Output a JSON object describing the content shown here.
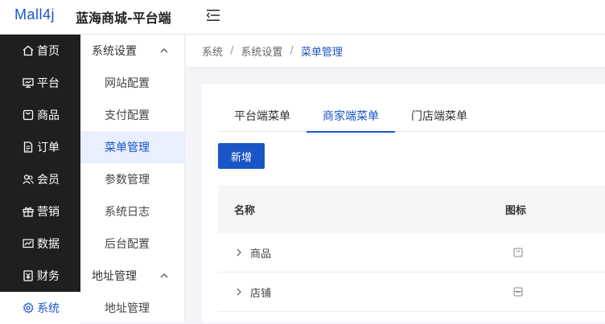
{
  "header": {
    "logo_text": "Mall4j",
    "app_title": "蓝海商城-平台端"
  },
  "primary_nav": [
    {
      "label": "首页",
      "icon": "home-icon"
    },
    {
      "label": "平台",
      "icon": "monitor-icon"
    },
    {
      "label": "商品",
      "icon": "goods-icon"
    },
    {
      "label": "订单",
      "icon": "order-icon"
    },
    {
      "label": "会员",
      "icon": "member-icon"
    },
    {
      "label": "营销",
      "icon": "gift-icon"
    },
    {
      "label": "数据",
      "icon": "chart-icon"
    },
    {
      "label": "财务",
      "icon": "finance-icon"
    },
    {
      "label": "系统",
      "icon": "gear-icon",
      "active": true
    }
  ],
  "secondary_nav": {
    "group1": "系统设置",
    "group1_items": [
      "网站配置",
      "支付配置",
      "菜单管理",
      "参数管理",
      "系统日志",
      "后台配置"
    ],
    "group2": "地址管理",
    "group2_items": [
      "地址管理"
    ]
  },
  "breadcrumb": [
    "系统",
    "系统设置",
    "菜单管理"
  ],
  "tabs": [
    "平台端菜单",
    "商家端菜单",
    "门店端菜单"
  ],
  "add_button": "新增",
  "table": {
    "columns": [
      "名称",
      "图标"
    ],
    "rows": [
      {
        "name": "商品",
        "icon": "bag-icon"
      },
      {
        "name": "店铺",
        "icon": "store-icon"
      }
    ]
  },
  "colors": {
    "accent": "#1a55c6",
    "sidebar_dark": "#1f1f1f",
    "active_bg": "#e8efff"
  }
}
